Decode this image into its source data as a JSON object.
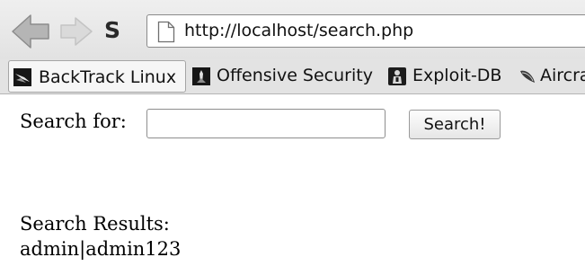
{
  "browser": {
    "nav": {
      "back_icon": "back-arrow-icon",
      "forward_icon": "forward-arrow-icon",
      "stop_icon_glyph": "S",
      "address": "http://localhost/search.php"
    },
    "bookmarks": [
      {
        "label": "BackTrack Linux",
        "icon": "backtrack-icon",
        "active": true
      },
      {
        "label": "Offensive Security",
        "icon": "offensive-security-icon",
        "active": false
      },
      {
        "label": "Exploit-DB",
        "icon": "exploit-db-icon",
        "active": false
      },
      {
        "label": "Aircra",
        "icon": "aircrack-icon",
        "active": false
      }
    ]
  },
  "page": {
    "search_label": "Search for:",
    "search_value": "",
    "search_button": "Search!",
    "results_heading": "Search Results:",
    "results": [
      "admin|admin123"
    ]
  },
  "colors": {
    "toolbar_bg": "#e3e3e3",
    "arrow_disabled": "#c9c9c9",
    "arrow_fill": "#a4a4a4",
    "text": "#111111"
  }
}
